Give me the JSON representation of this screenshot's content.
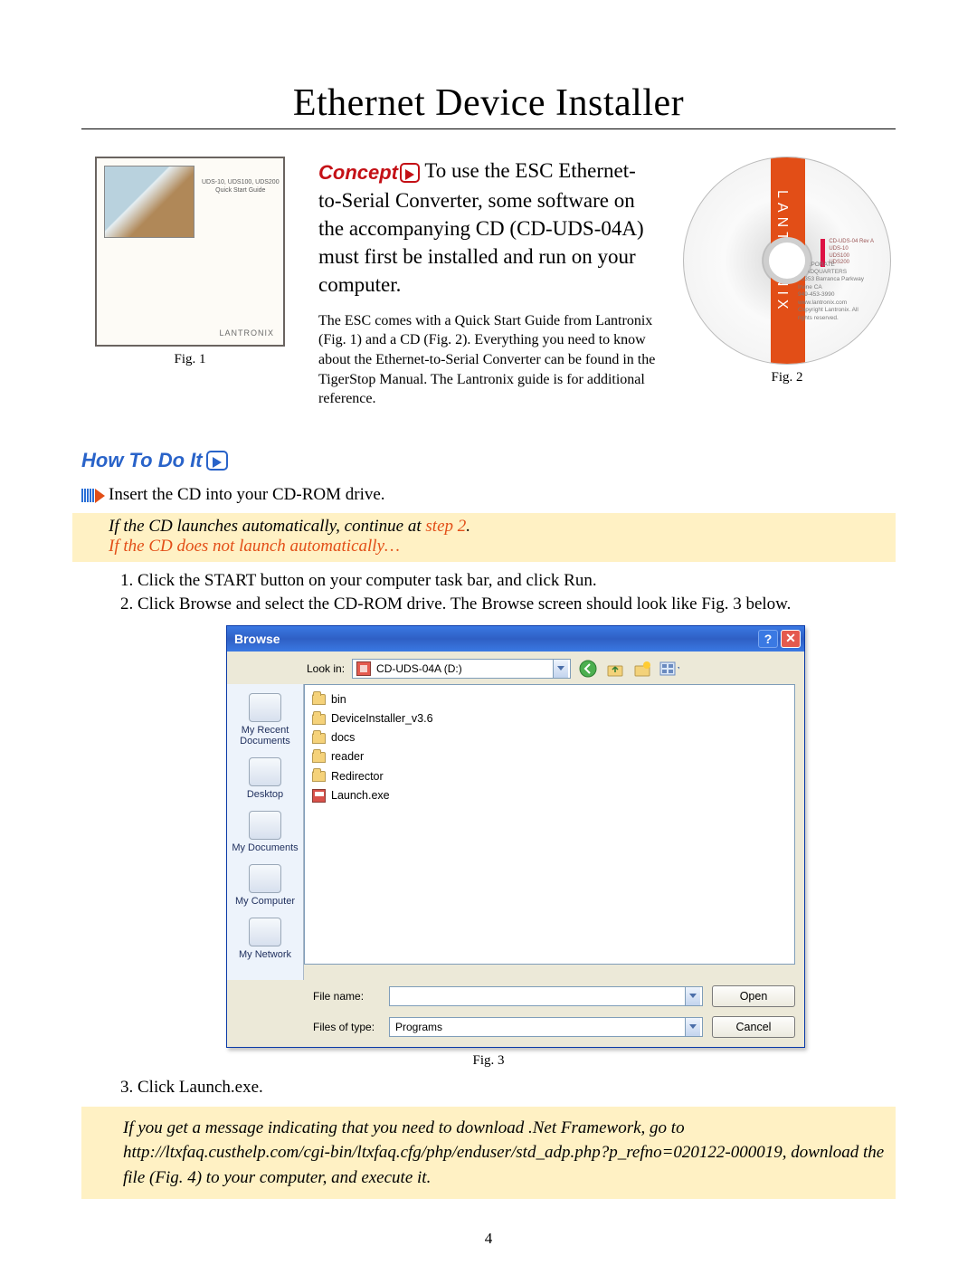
{
  "page_title": "Ethernet Device Installer",
  "concept_label": "Concept",
  "concept_text": "To use the ESC Ethernet-to-Serial Converter, some software on the accompanying CD (CD-UDS-04A) must first be installed and run on your computer.",
  "concept_sub": "The ESC comes with a Quick Start Guide from Lantronix (Fig. 1) and a CD (Fig. 2). Everything you need to know about the Ethernet-to-Serial Converter can be found in the TigerStop Manual. The Lantronix guide is for additional reference.",
  "fig1": {
    "caption": "Fig. 1",
    "title1": "UDS-10, UDS100, UDS200",
    "title2": "Quick Start Guide",
    "brand": "LANTRONIX"
  },
  "fig2": {
    "caption": "Fig. 2",
    "brand": "LANTRONIX",
    "tiny": "CD-UDS-04  Rev A\nUDS-10\nUDS100\nUDS200",
    "blurb": "CORPORATE HEADQUARTERS\n15353 Barranca Parkway Irvine CA\n949-453-3990 www.lantronix.com\nCopyright Lantronix. All rights reserved."
  },
  "howto_label": "How To Do It",
  "insert_line": "Insert the CD into your CD-ROM drive.",
  "highlight1_line1": "If the CD launches automatically, continue at ",
  "highlight1_step": "step 2",
  "highlight1_end": ".",
  "highlight1_line2": "If the CD does not launch automatically…",
  "steps": [
    "Click the START button on your computer task bar, and click Run.",
    "Click Browse and select the CD-ROM drive. The Browse screen should look like Fig. 3 below."
  ],
  "browse": {
    "title": "Browse",
    "lookin_label": "Look in:",
    "lookin_value": "CD-UDS-04A (D:)",
    "places": [
      "My Recent Documents",
      "Desktop",
      "My Documents",
      "My Computer",
      "My Network"
    ],
    "files": [
      {
        "type": "folder",
        "name": "bin"
      },
      {
        "type": "folder",
        "name": "DeviceInstaller_v3.6"
      },
      {
        "type": "folder",
        "name": "docs"
      },
      {
        "type": "folder",
        "name": "reader"
      },
      {
        "type": "folder",
        "name": "Redirector"
      },
      {
        "type": "exe",
        "name": "Launch.exe"
      }
    ],
    "filename_label": "File name:",
    "filename_value": "",
    "filetypes_label": "Files of type:",
    "filetypes_value": "Programs",
    "open": "Open",
    "cancel": "Cancel",
    "help": "?",
    "close": "✕"
  },
  "fig3_caption": "Fig. 3",
  "step3": "Click Launch.exe.",
  "highlight2_a": "If you get a message indicating that you need to download .Net Framework, go to ",
  "highlight2_url": "http://ltxfaq.custhelp.com/cgi-bin/ltxfaq.cfg/php/enduser/std_adp.php?p_refno=020122-000019",
  "highlight2_b": ", download the file (Fig. 4) to your computer, and execute it.",
  "page_number": "4"
}
